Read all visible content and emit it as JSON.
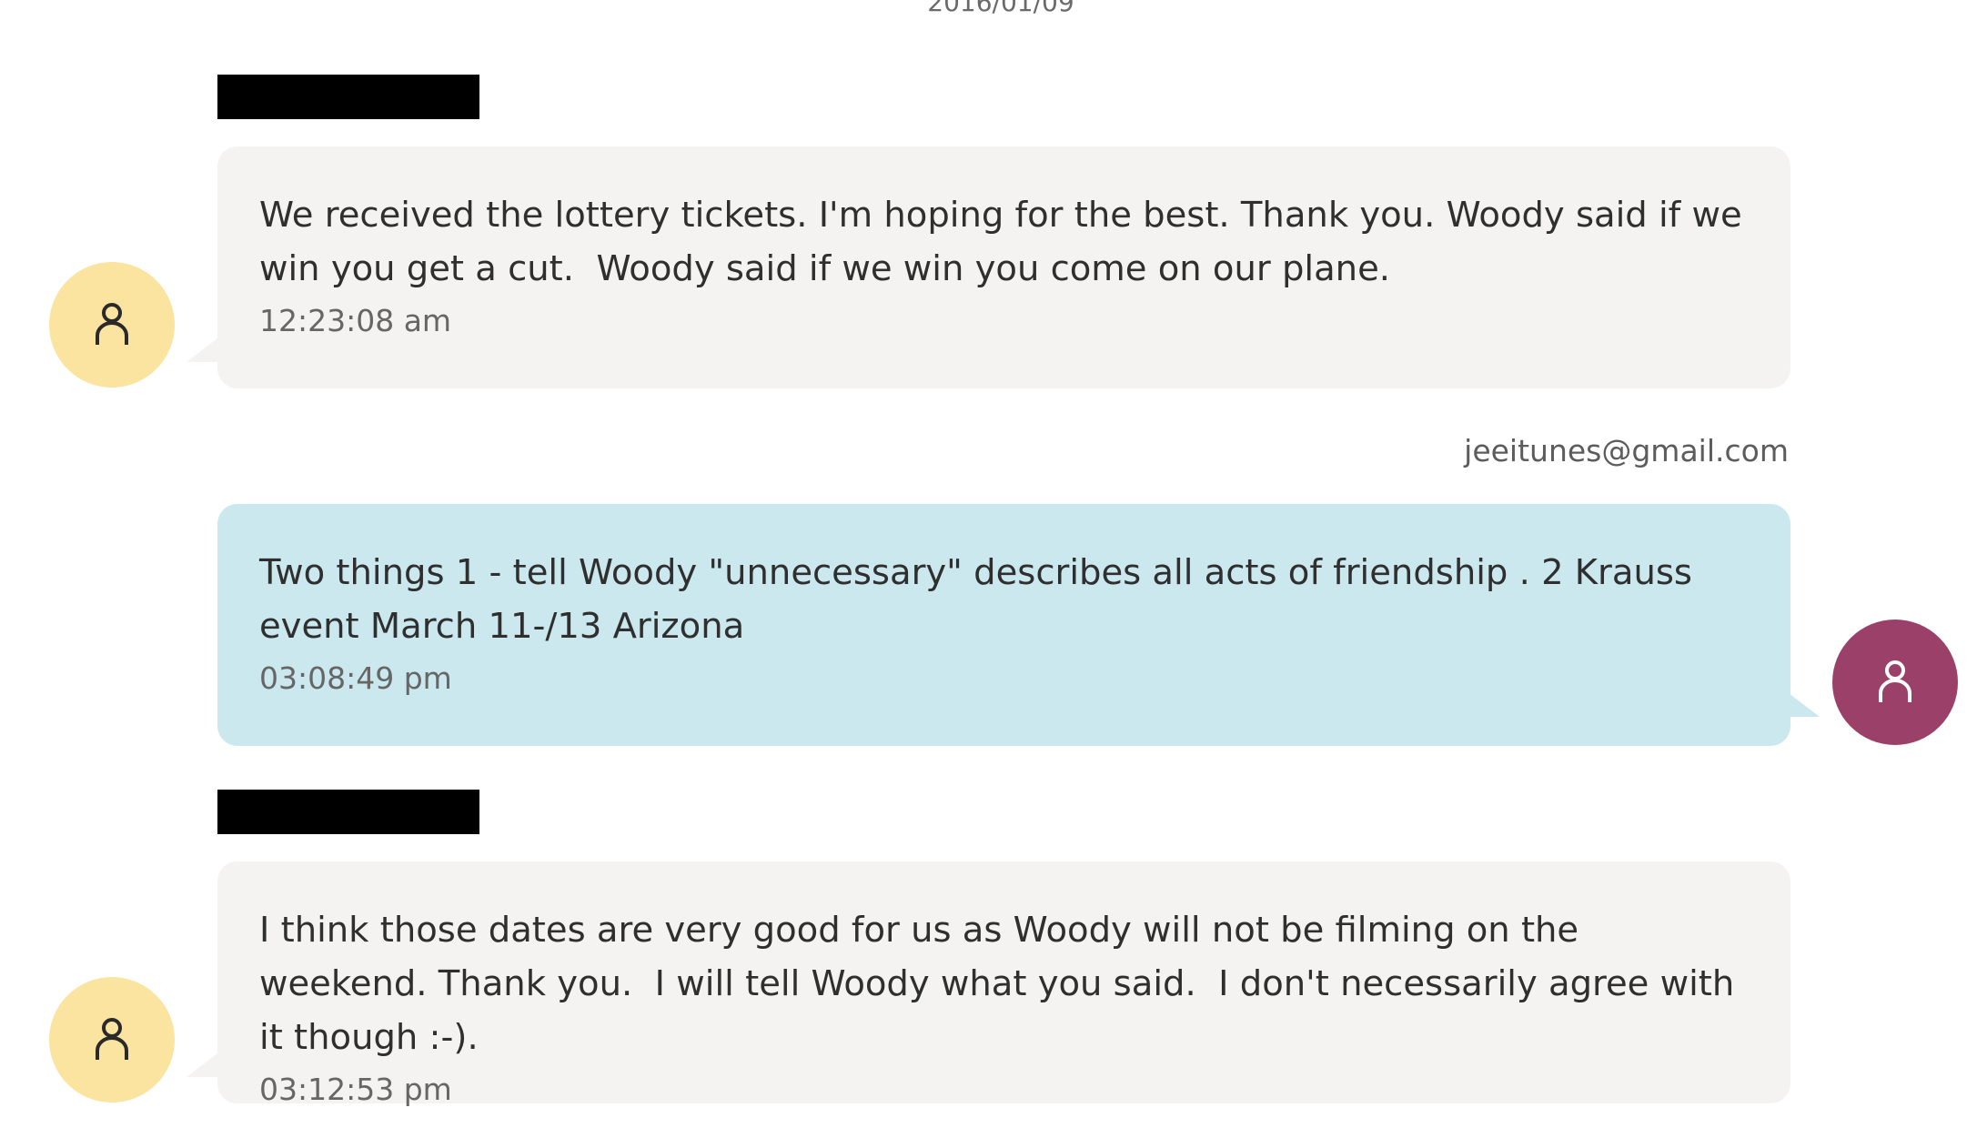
{
  "date_header": "2016/01/09",
  "colors": {
    "incoming_bubble": "#f4f3f1",
    "outgoing_bubble": "#cae8ee",
    "incoming_avatar": "#fbe3a0",
    "outgoing_avatar": "#9b4069",
    "redaction": "#000000"
  },
  "messages": [
    {
      "direction": "incoming",
      "sender_redacted": true,
      "avatar_icon": "person-icon",
      "text": "We received the lottery tickets. I'm hoping for the best. Thank you. Woody said if we win you get a cut.  Woody said if we win you come on our plane.",
      "time": "12:23:08 am"
    },
    {
      "direction": "outgoing",
      "sender": "jeeitunes@gmail.com",
      "avatar_icon": "person-icon",
      "text": "Two things 1 - tell Woody \"unnecessary\" describes all acts of friendship . 2 Krauss event March 11-/13 Arizona",
      "time": "03:08:49 pm"
    },
    {
      "direction": "incoming",
      "sender_redacted": true,
      "avatar_icon": "person-icon",
      "text": "I think those dates are very good for us as Woody will not be filming on the weekend. Thank you.  I will tell Woody what you said.  I don't necessarily agree with it though :-).",
      "time": "03:12:53 pm"
    }
  ]
}
